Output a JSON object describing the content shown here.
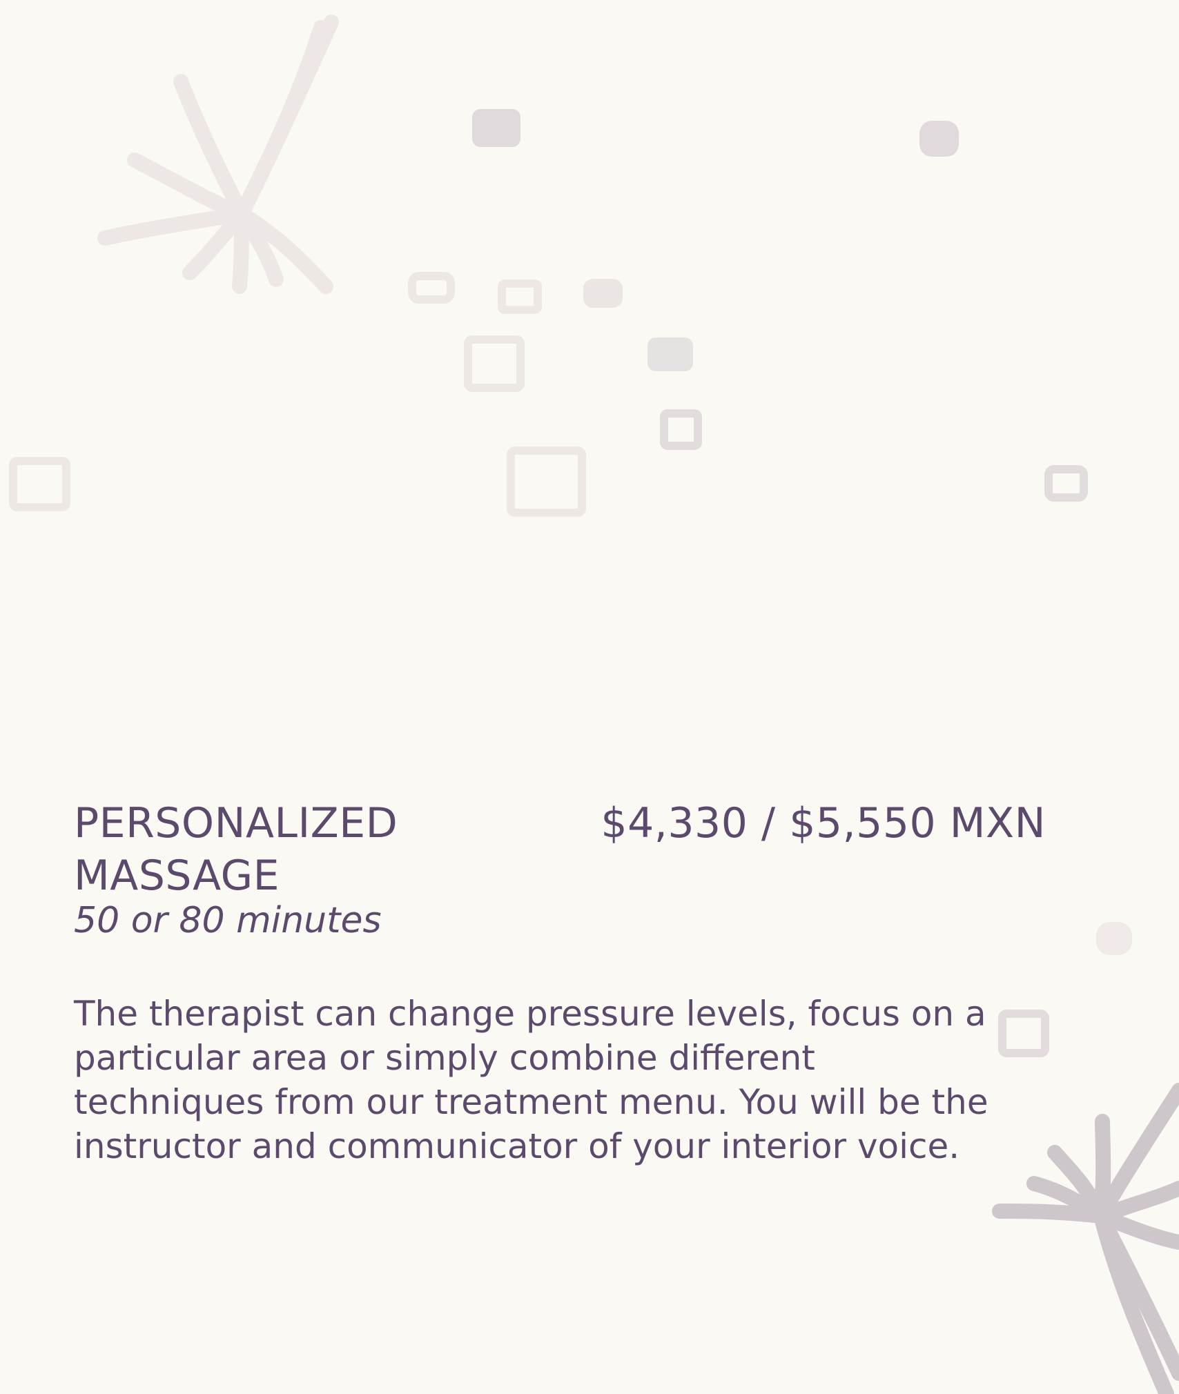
{
  "service": {
    "title": "PERSONALIZED MASSAGE",
    "price": "$4,330 / $5,550 MXN",
    "duration": "50 or 80 minutes",
    "description": "The therapist can change pressure levels, focus on a particular area or simply combine different techniques from our treatment menu. You will be the instructor and communicator of your interior voice."
  },
  "decoration": {
    "light_stroke_color": "#ede8e6",
    "medium_stroke_color": "#dcd6d8",
    "dark_stroke_color": "#cdc6cb"
  }
}
